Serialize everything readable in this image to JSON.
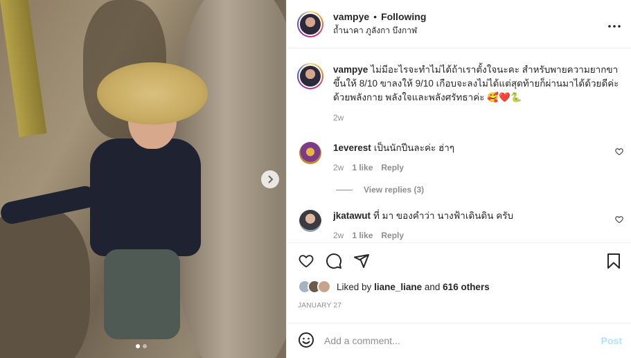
{
  "post": {
    "username": "vampye",
    "separator": "•",
    "follow_status": "Following",
    "location": "ถ้ำนาคา ภูลังกา บึงกาฬ",
    "more_icon": "more-horizontal-icon"
  },
  "caption": {
    "username": "vampye",
    "text": "ไม่มีอะไรจะทำไม่ได้ถ้าเราตั้งใจนะคะ สำหรับพายความยากขาขึ้นให้ 8/10 ขาลงให้ 9/10 เกือบจะลงไม่ได้แต่สุดท้ายก็ผ่านมาได้ด้วยดีค่ะ ด้วยพลังกาย พลังใจและพลังศรัทธาค่ะ 🥰❤️🐍",
    "age": "2w"
  },
  "comments": [
    {
      "username": "1everest",
      "text": "เป็นนักปีนละค่ะ ฮ่าๆ",
      "age": "2w",
      "likes": "1 like",
      "reply_label": "Reply",
      "view_replies": "View replies (3)",
      "avatar_color": "#c48a2a"
    },
    {
      "username": "jkatawut",
      "text": "ที่ มา ของคำว่า นางฟ้าเดินดิน ครับ",
      "age": "2w",
      "likes": "1 like",
      "reply_label": "Reply",
      "avatar_color": "#6b6f78"
    }
  ],
  "actions": {
    "icons": [
      "heart-icon",
      "comment-icon",
      "share-icon",
      "bookmark-icon"
    ]
  },
  "likes": {
    "prefix": "Liked by",
    "user": "liane_liane",
    "joiner": "and",
    "others": "616 others",
    "liker_colors": [
      "#a7b3c4",
      "#6f5a4a",
      "#c9a38c"
    ]
  },
  "date": "JANUARY 27",
  "add_comment": {
    "placeholder": "Add a comment...",
    "post_label": "Post",
    "emoji_icon": "emoji-icon"
  },
  "colors": {
    "accent": "#0095f6",
    "post_disabled": "#b2dffc",
    "muted": "#8e8e8e",
    "text": "#262626"
  }
}
